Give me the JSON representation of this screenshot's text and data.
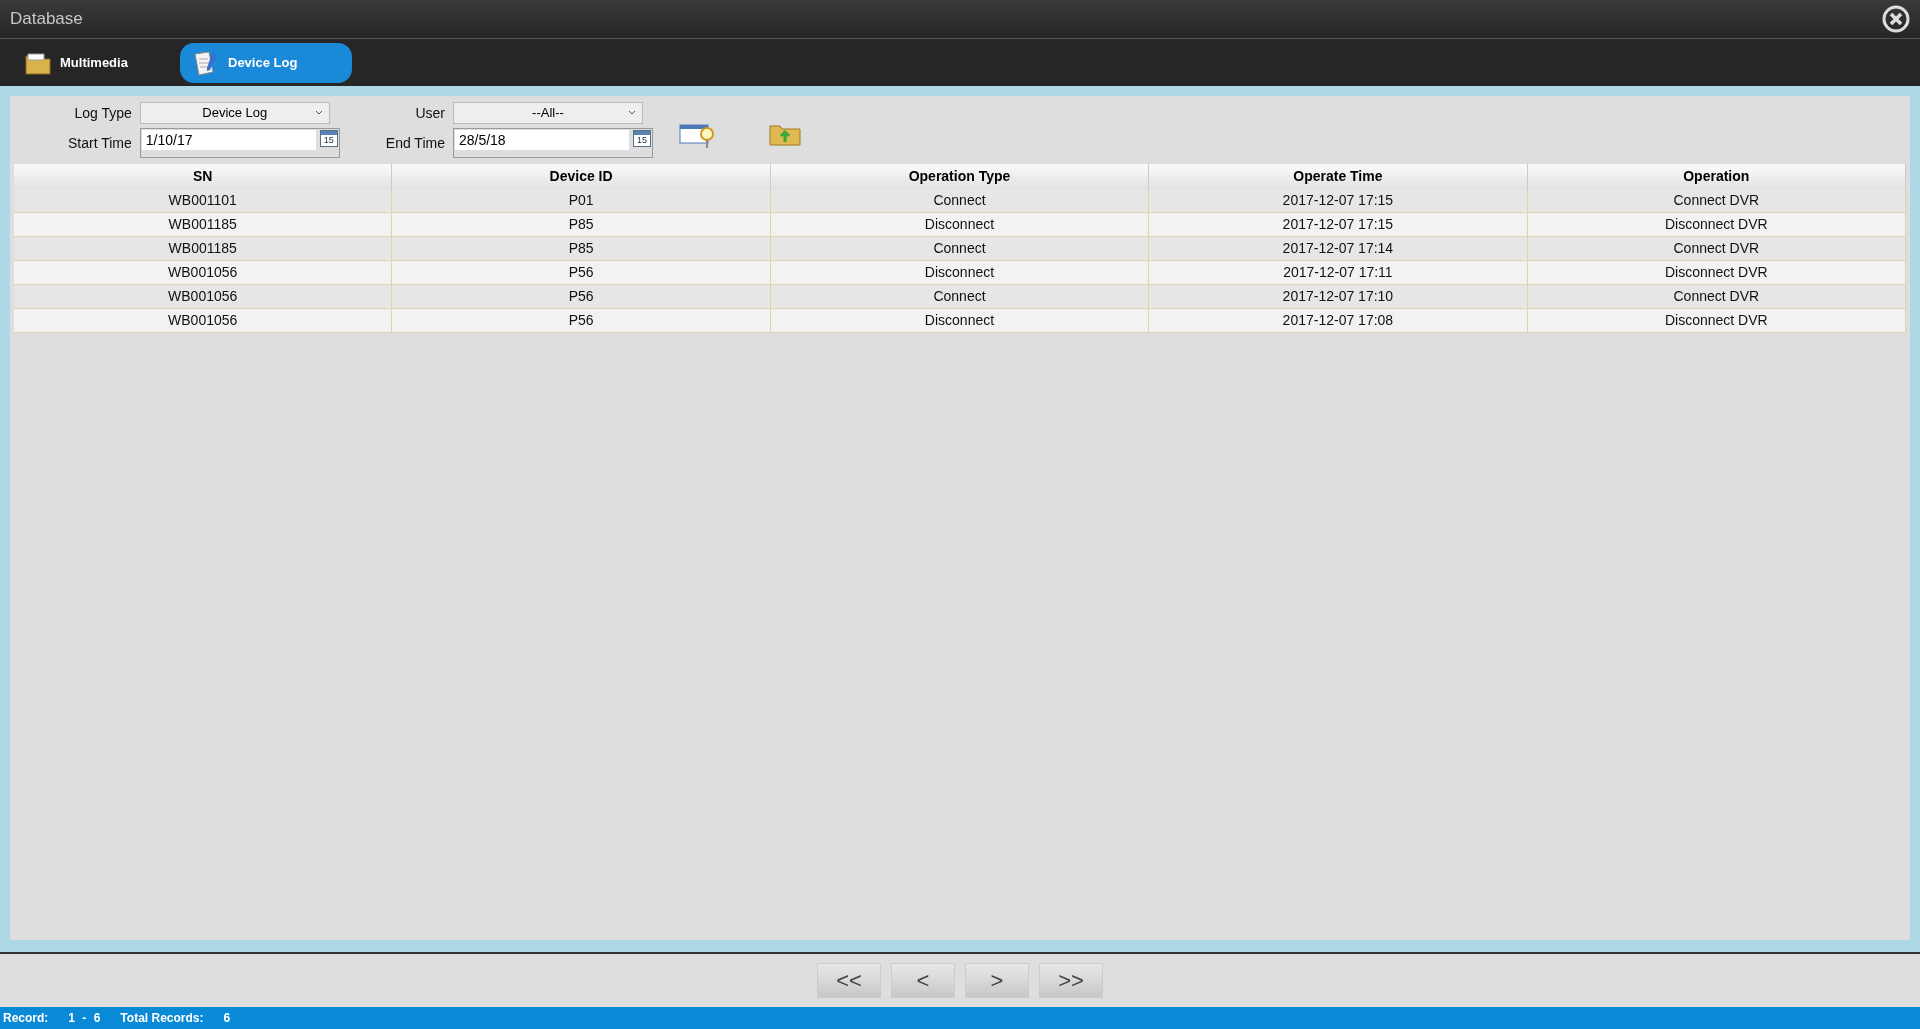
{
  "window": {
    "title": "Database"
  },
  "tabs": [
    {
      "label": "Multimedia",
      "selected": false,
      "kind": "multimedia"
    },
    {
      "label": "Device Log",
      "selected": true,
      "kind": "log"
    }
  ],
  "filters": {
    "log_type": {
      "label": "Log Type",
      "value": "Device Log"
    },
    "user": {
      "label": "User",
      "value": "--All--"
    },
    "start_time": {
      "label": "Start Time",
      "value": "1/10/17",
      "calendar_day": "15"
    },
    "end_time": {
      "label": "End Time",
      "value": "28/5/18",
      "calendar_day": "15"
    }
  },
  "table": {
    "columns": [
      "SN",
      "Device ID",
      "Operation Type",
      "Operate Time",
      "Operation"
    ],
    "rows": [
      [
        "WB001101",
        "P01",
        "Connect",
        "2017-12-07 17:15",
        "Connect DVR"
      ],
      [
        "WB001185",
        "P85",
        "Disconnect",
        "2017-12-07 17:15",
        "Disconnect DVR"
      ],
      [
        "WB001185",
        "P85",
        "Connect",
        "2017-12-07 17:14",
        "Connect DVR"
      ],
      [
        "WB001056",
        "P56",
        "Disconnect",
        "2017-12-07 17:11",
        "Disconnect DVR"
      ],
      [
        "WB001056",
        "P56",
        "Connect",
        "2017-12-07 17:10",
        "Connect DVR"
      ],
      [
        "WB001056",
        "P56",
        "Disconnect",
        "2017-12-07 17:08",
        "Disconnect DVR"
      ]
    ]
  },
  "pagination": [
    "<<",
    "<",
    ">",
    ">>"
  ],
  "status_bar": {
    "record_label": "Record:",
    "record_range": "1 - 6",
    "total_label": "Total Records:",
    "total": "6"
  }
}
